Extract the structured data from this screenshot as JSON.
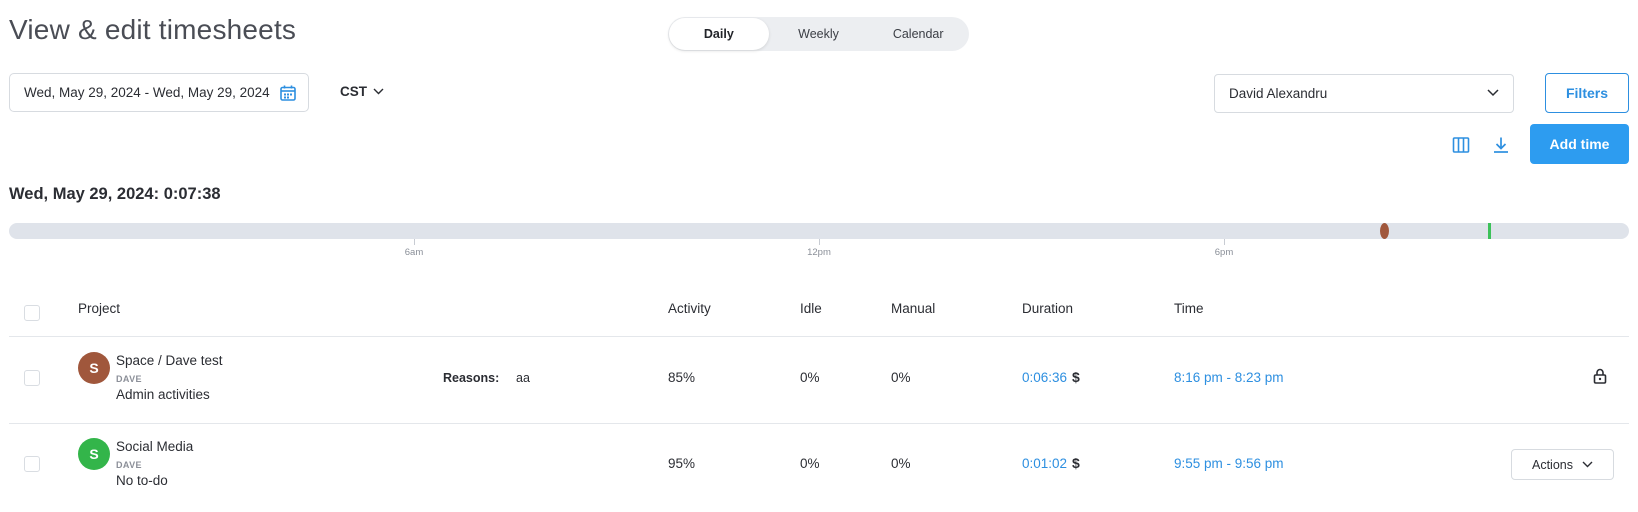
{
  "page": {
    "title": "View & edit timesheets"
  },
  "view_switcher": {
    "tabs": [
      {
        "label": "Daily",
        "active": true
      },
      {
        "label": "Weekly",
        "active": false
      },
      {
        "label": "Calendar",
        "active": false
      }
    ]
  },
  "toolbar": {
    "date_range": "Wed, May 29, 2024 - Wed, May 29, 2024",
    "timezone": "CST",
    "member": "David Alexandru",
    "filters_label": "Filters",
    "add_time_label": "Add time",
    "columns_icon": "columns-icon",
    "download_icon": "download-icon"
  },
  "summary": {
    "text": "Wed, May 29, 2024: 0:07:38"
  },
  "timeline": {
    "ticks": [
      "6am",
      "12pm",
      "6pm"
    ],
    "segments": [
      {
        "color": "#a0573c"
      },
      {
        "color": "#3cc159"
      }
    ]
  },
  "table": {
    "headers": {
      "project": "Project",
      "activity": "Activity",
      "idle": "Idle",
      "manual": "Manual",
      "duration": "Duration",
      "time": "Time"
    },
    "rows": [
      {
        "avatar_letter": "S",
        "avatar_color": "#a0573c",
        "project": "Space / Dave test",
        "user": "DAVE",
        "todo": "Admin activities",
        "reasons_label": "Reasons:",
        "reasons_value": "aa",
        "activity": "85%",
        "idle": "0%",
        "manual": "0%",
        "duration": "0:06:36",
        "billable_symbol": "$",
        "time": "8:16 pm - 8:23 pm",
        "status_icon": "lock-icon"
      },
      {
        "avatar_letter": "S",
        "avatar_color": "#33b54a",
        "project": "Social Media",
        "user": "DAVE",
        "todo": "No to-do",
        "activity": "95%",
        "idle": "0%",
        "manual": "0%",
        "duration": "0:01:02",
        "billable_symbol": "$",
        "time": "9:55 pm - 9:56 pm",
        "actions_label": "Actions"
      }
    ]
  }
}
